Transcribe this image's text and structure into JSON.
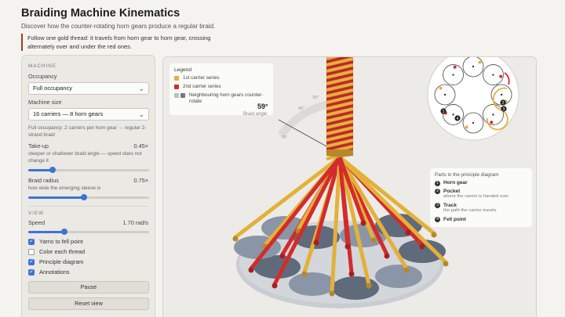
{
  "header": {
    "title": "Braiding Machine Kinematics",
    "subtitle": "Discover how the counter-rotating horn gears produce a regular braid.",
    "callout": "Follow one gold thread: it travels from horn gear to horn gear, crossing alternately over and under the red ones."
  },
  "panel": {
    "machine_heading": "MACHINE",
    "occupancy_label": "Occupancy",
    "occupancy_value": "Full occupancy",
    "size_label": "Machine size",
    "size_value": "16 carriers — 8 horn gears",
    "occupancy_note": "Full occupancy: 2 carriers per horn gear → regular 2-strand braid",
    "takeup_label": "Take-up",
    "takeup_value": "0.45×",
    "takeup_note": "steeper or shallower braid angle — speed does not change it",
    "takeup_level": 0.2,
    "radius_label": "Braid radius",
    "radius_value": "0.75×",
    "radius_note": "how wide the emerging sleeve is",
    "radius_level": 0.46,
    "view_heading": "VIEW",
    "speed_label": "Speed",
    "speed_value": "1.70 rad/s",
    "speed_level": 0.3,
    "checks": [
      {
        "label": "Yarns to fell point",
        "checked": true
      },
      {
        "label": "Color each thread",
        "checked": false
      },
      {
        "label": "Principle diagram",
        "checked": true
      },
      {
        "label": "Annotations",
        "checked": true
      }
    ],
    "pause_label": "Pause",
    "reset_label": "Reset view"
  },
  "legend": {
    "heading": "Legend",
    "items": [
      {
        "label": "1st carrier series",
        "color": "#e3b13a"
      },
      {
        "label": "2nd carrier series",
        "color": "#d32b2b"
      },
      {
        "label": "Neighbouring horn gears counter-rotate",
        "color": "#9aa3b0"
      }
    ]
  },
  "angle": {
    "value": "59°",
    "label": "Braid angle",
    "ticks": [
      "30°",
      "45°",
      "75°"
    ]
  },
  "parts": {
    "heading": "Parts in the principle diagram",
    "items": [
      {
        "num": "1",
        "title": "Horn gear",
        "desc": ""
      },
      {
        "num": "2",
        "title": "Pocket",
        "desc": "where the carrier is handed over"
      },
      {
        "num": "3",
        "title": "Track",
        "desc": "the path the carrier travels"
      },
      {
        "num": "4",
        "title": "Fell point",
        "desc": ""
      }
    ]
  },
  "colors": {
    "gold": "#e3b13a",
    "red": "#d32b2b",
    "accent": "#3b73d9",
    "gear": "#8a96a6"
  }
}
